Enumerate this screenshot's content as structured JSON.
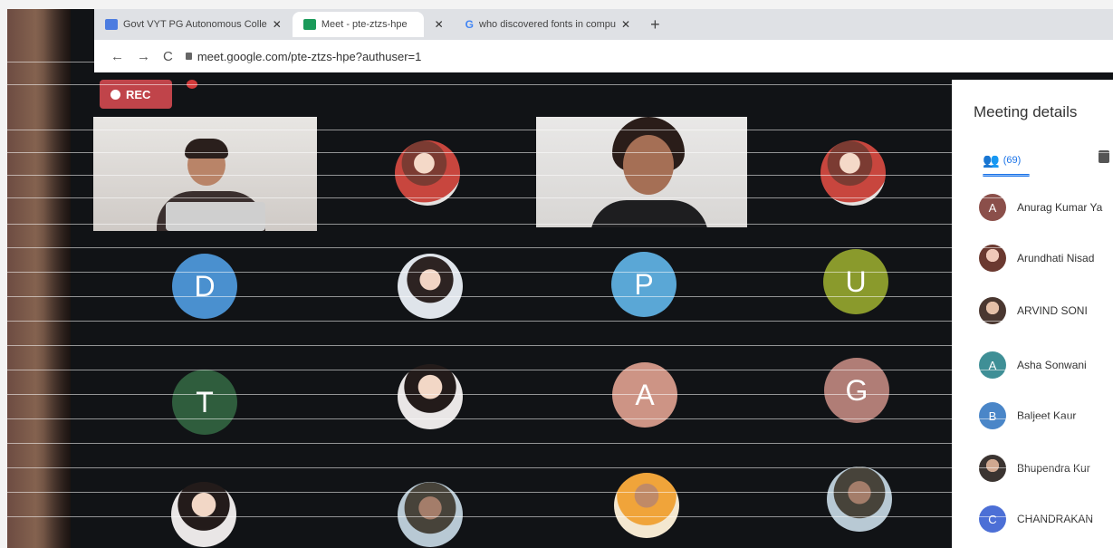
{
  "browser": {
    "tabs": [
      {
        "title": "Govt VYT PG Autonomous Colle",
        "close": "✕"
      },
      {
        "title": "Meet - pte-ztzs-hpe",
        "close": ""
      },
      {
        "title": "",
        "close": "✕"
      },
      {
        "title": "who discovered fonts in compu",
        "close": "✕"
      }
    ],
    "new_tab": "+",
    "url": "meet.google.com/pte-ztzs-hpe?authuser=1"
  },
  "meeting": {
    "rec_label": "REC",
    "tiles": [
      {
        "type": "initial",
        "letter": "D",
        "color": "#4a90cf"
      },
      {
        "type": "initial",
        "letter": "P",
        "color": "#5aa7d6"
      },
      {
        "type": "initial",
        "letter": "U",
        "color": "#8a9a2c"
      },
      {
        "type": "initial",
        "letter": "T",
        "color": "#2f5d3d"
      },
      {
        "type": "initial",
        "letter": "A",
        "color": "#cd9485"
      },
      {
        "type": "initial",
        "letter": "G",
        "color": "#b07d76"
      }
    ]
  },
  "panel": {
    "title": "Meeting details",
    "people_count": "(69)",
    "participants": [
      {
        "name": "Anurag Kumar Ya",
        "initial": "A",
        "color": "#8b4f4a"
      },
      {
        "name": "Arundhati Nisad",
        "initial": "",
        "color": ""
      },
      {
        "name": "ARVIND SONI",
        "initial": "",
        "color": ""
      },
      {
        "name": "Asha Sonwani",
        "initial": "A",
        "color": "#3f8f96"
      },
      {
        "name": "Baljeet Kaur",
        "initial": "B",
        "color": "#4a86c8"
      },
      {
        "name": "Bhupendra Kur",
        "initial": "",
        "color": ""
      },
      {
        "name": "CHANDRAKAN",
        "initial": "C",
        "color": "#4c6fd6"
      }
    ]
  }
}
